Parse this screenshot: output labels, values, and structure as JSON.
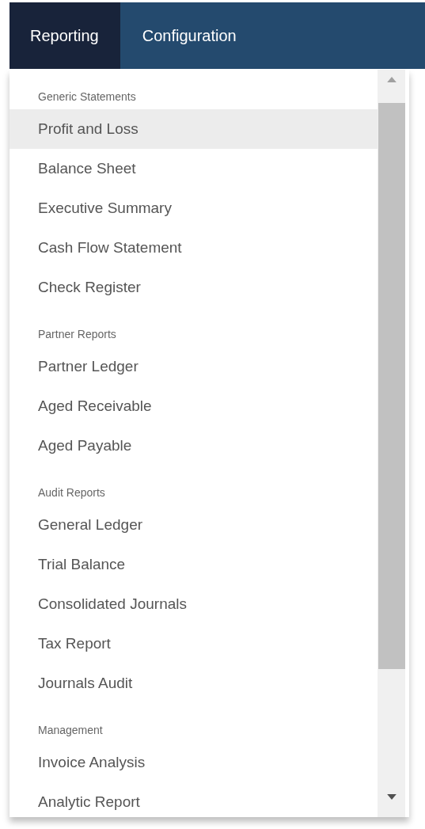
{
  "navbar": {
    "tabs": [
      {
        "label": "Reporting",
        "selected": true
      },
      {
        "label": "Configuration",
        "selected": false
      }
    ]
  },
  "menu": {
    "sections": [
      {
        "header": "Generic Statements",
        "items": [
          {
            "label": "Profit and Loss",
            "selected": true
          },
          {
            "label": "Balance Sheet",
            "selected": false
          },
          {
            "label": "Executive Summary",
            "selected": false
          },
          {
            "label": "Cash Flow Statement",
            "selected": false
          },
          {
            "label": "Check Register",
            "selected": false
          }
        ]
      },
      {
        "header": "Partner Reports",
        "items": [
          {
            "label": "Partner Ledger",
            "selected": false
          },
          {
            "label": "Aged Receivable",
            "selected": false
          },
          {
            "label": "Aged Payable",
            "selected": false
          }
        ]
      },
      {
        "header": "Audit Reports",
        "items": [
          {
            "label": "General Ledger",
            "selected": false
          },
          {
            "label": "Trial Balance",
            "selected": false
          },
          {
            "label": "Consolidated Journals",
            "selected": false
          },
          {
            "label": "Tax Report",
            "selected": false
          },
          {
            "label": "Journals Audit",
            "selected": false
          }
        ]
      },
      {
        "header": "Management",
        "items": [
          {
            "label": "Invoice Analysis",
            "selected": false
          },
          {
            "label": "Analytic Report",
            "selected": false
          }
        ]
      }
    ]
  }
}
